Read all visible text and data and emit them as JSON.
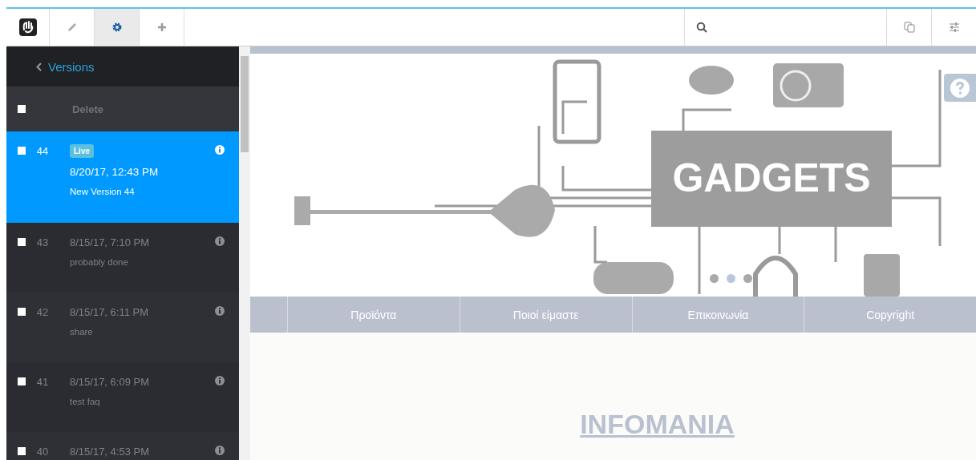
{
  "toolbar": {
    "tabs": [
      {
        "kind": "pencil",
        "selected": false
      },
      {
        "kind": "gear",
        "selected": true
      },
      {
        "kind": "plus",
        "selected": false
      }
    ]
  },
  "panel": {
    "title": "Versions",
    "delete_label": "Delete",
    "select_all": {
      "checked": false
    },
    "versions": [
      {
        "number": "44",
        "badge": "Live",
        "date": "8/20/17, 12:43 PM",
        "comment": "New Version 44",
        "checked": false,
        "selected": true
      },
      {
        "number": "43",
        "date": "8/15/17, 7:10 PM",
        "comment": "probably done",
        "checked": false,
        "selected": false
      },
      {
        "number": "42",
        "date": "8/15/17, 6:11 PM",
        "comment": "share",
        "checked": false,
        "selected": false
      },
      {
        "number": "41",
        "date": "8/15/17, 6:09 PM",
        "comment": "test faq",
        "checked": false,
        "selected": false
      },
      {
        "number": "40",
        "date": "8/15/17, 4:53 PM",
        "checked": false,
        "selected": false
      }
    ]
  },
  "banner": {
    "title": "GADGETS",
    "dots": [
      {
        "selected": false
      },
      {
        "selected": true
      },
      {
        "selected": false
      }
    ]
  },
  "nav": [
    "Προϊόντα",
    "Ποιοί είμαστε",
    "Επικοινωνία",
    "Copyright"
  ],
  "page": {
    "heading": "INFOMANIA"
  }
}
